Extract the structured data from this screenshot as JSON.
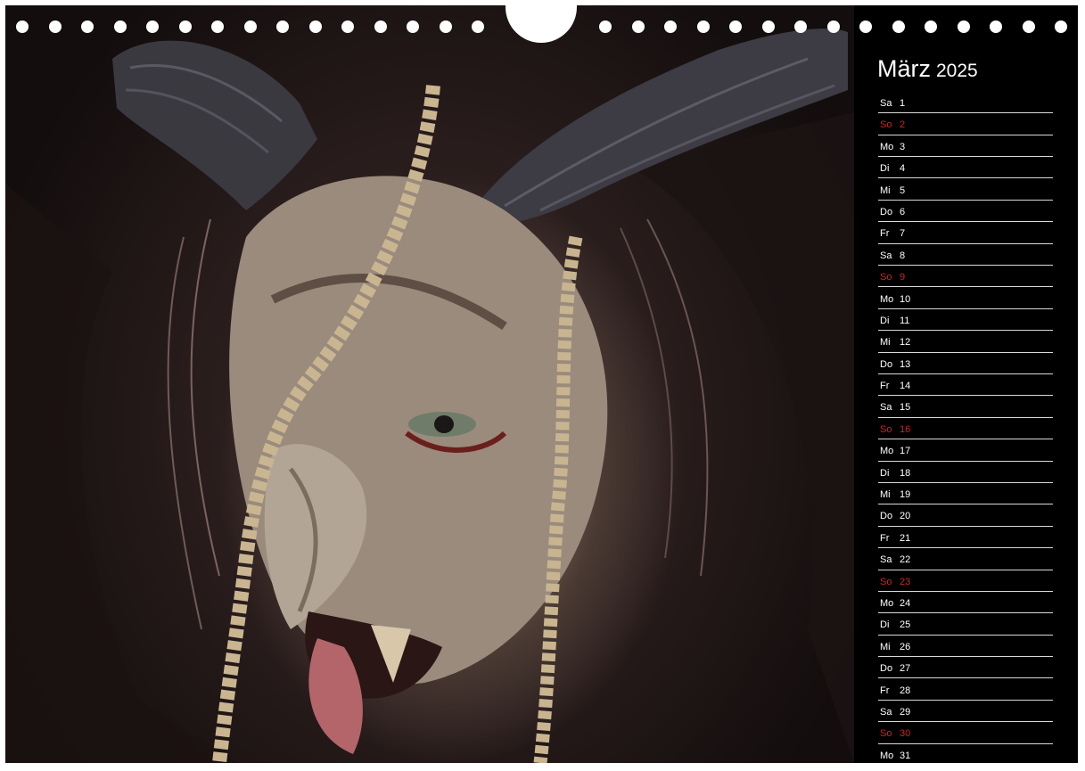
{
  "calendar": {
    "month": "März",
    "year": "2025",
    "days": [
      {
        "dn": "Sa",
        "num": "1"
      },
      {
        "dn": "So",
        "num": "2",
        "sunday": true
      },
      {
        "dn": "Mo",
        "num": "3"
      },
      {
        "dn": "Di",
        "num": "4"
      },
      {
        "dn": "Mi",
        "num": "5"
      },
      {
        "dn": "Do",
        "num": "6"
      },
      {
        "dn": "Fr",
        "num": "7"
      },
      {
        "dn": "Sa",
        "num": "8"
      },
      {
        "dn": "So",
        "num": "9",
        "sunday": true
      },
      {
        "dn": "Mo",
        "num": "10"
      },
      {
        "dn": "Di",
        "num": "11"
      },
      {
        "dn": "Mi",
        "num": "12"
      },
      {
        "dn": "Do",
        "num": "13"
      },
      {
        "dn": "Fr",
        "num": "14"
      },
      {
        "dn": "Sa",
        "num": "15"
      },
      {
        "dn": "So",
        "num": "16",
        "sunday": true
      },
      {
        "dn": "Mo",
        "num": "17"
      },
      {
        "dn": "Di",
        "num": "18"
      },
      {
        "dn": "Mi",
        "num": "19"
      },
      {
        "dn": "Do",
        "num": "20"
      },
      {
        "dn": "Fr",
        "num": "21"
      },
      {
        "dn": "Sa",
        "num": "22"
      },
      {
        "dn": "So",
        "num": "23",
        "sunday": true
      },
      {
        "dn": "Mo",
        "num": "24"
      },
      {
        "dn": "Di",
        "num": "25"
      },
      {
        "dn": "Mi",
        "num": "26"
      },
      {
        "dn": "Do",
        "num": "27"
      },
      {
        "dn": "Fr",
        "num": "28"
      },
      {
        "dn": "Sa",
        "num": "29"
      },
      {
        "dn": "So",
        "num": "30",
        "sunday": true
      },
      {
        "dn": "Mo",
        "num": "31"
      }
    ]
  },
  "colors": {
    "panel_background": "#000000",
    "text": "#ffffff",
    "sunday": "#c62828",
    "rule": "#d9d9d9"
  },
  "photo": {
    "subject": "krampus-mask-icon"
  }
}
